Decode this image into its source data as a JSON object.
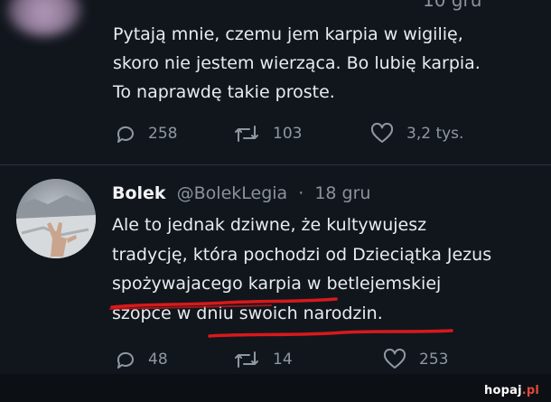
{
  "first_tweet": {
    "cropped_time": "10 gru",
    "text_lines": [
      "Pytają mnie, czemu jem karpia w wigilię,",
      "skoro nie jestem wierząca. Bo lubię karpia.",
      "To naprawdę takie proste."
    ],
    "actions": {
      "replies": "258",
      "retweets": "103",
      "likes": "3,2 tys."
    }
  },
  "reply_tweet": {
    "name": "Bolek",
    "handle": "@BolekLegia",
    "separator": "·",
    "date": "18 gru",
    "text_lines": [
      "Ale to jednak dziwne, że kultywujesz",
      "tradycję, która pochodzi od Dzieciątka Jezus",
      "spożywajacego karpia w betlejemskiej",
      "szopce w dniu swoich narodzin."
    ],
    "annotation_color": "#d8191b",
    "actions": {
      "replies": "48",
      "retweets": "14",
      "likes": "253"
    }
  },
  "watermark": {
    "brand": "hopaj",
    "suffix": ".pl"
  },
  "colors": {
    "background": "#11161d",
    "text": "#e9ecef",
    "muted": "#8a929b"
  }
}
